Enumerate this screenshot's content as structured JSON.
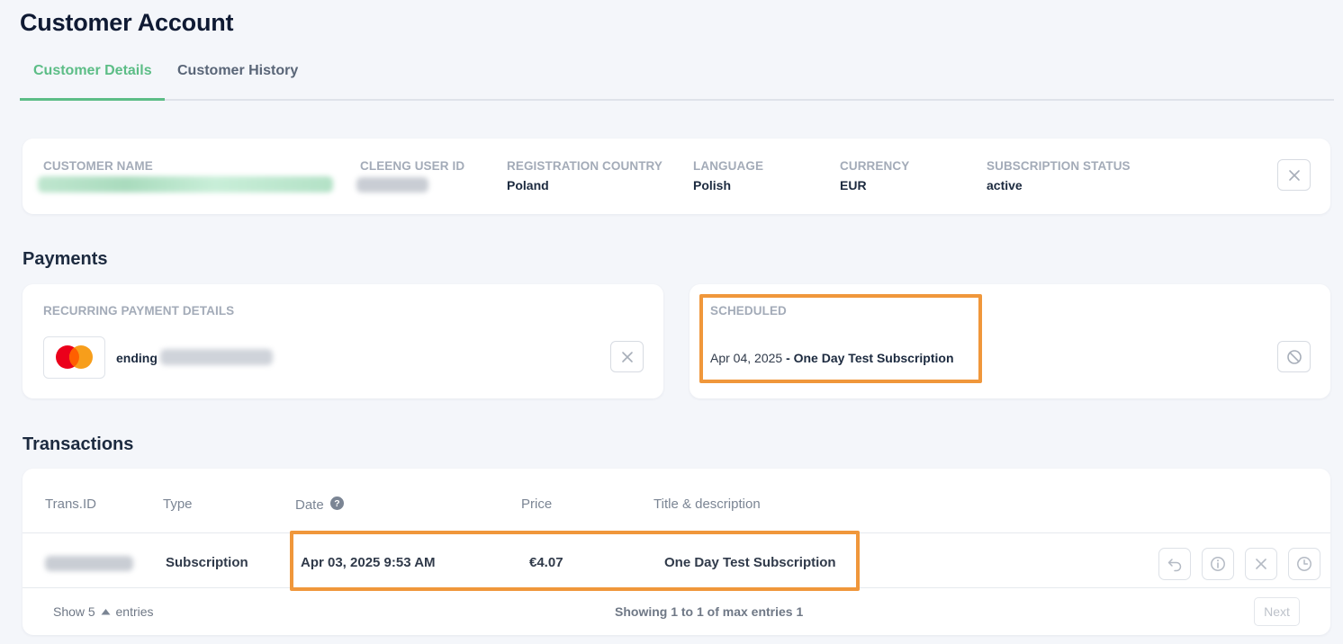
{
  "page": {
    "title": "Customer Account"
  },
  "tabs": [
    {
      "label": "Customer Details",
      "active": true
    },
    {
      "label": "Customer History",
      "active": false
    }
  ],
  "customer": {
    "name_label": "CUSTOMER NAME",
    "user_id_label": "CLEENG USER ID",
    "country_label": "REGISTRATION COUNTRY",
    "country": "Poland",
    "language_label": "LANGUAGE",
    "language": "Polish",
    "currency_label": "CURRENCY",
    "currency": "EUR",
    "status_label": "SUBSCRIPTION STATUS",
    "status": "active",
    "close_icon": "close-icon"
  },
  "payments": {
    "section_title": "Payments",
    "recurring_label": "RECURRING PAYMENT DETAILS",
    "card_brand_icon": "mastercard-icon",
    "ending_label": "ending",
    "scheduled_label": "SCHEDULED",
    "scheduled_date": "Apr 04, 2025",
    "scheduled_title": "- One Day Test Subscription",
    "cancel_icon": "block-icon"
  },
  "transactions": {
    "section_title": "Transactions",
    "columns": [
      "Trans.ID",
      "Type",
      "Date",
      "Price",
      "Title & description"
    ],
    "rows": [
      {
        "type": "Subscription",
        "date": "Apr 03, 2025 9:53 AM",
        "price": "€4.07",
        "title": "One Day Test Subscription"
      }
    ],
    "row_actions": [
      "undo-icon",
      "info-icon",
      "close-icon",
      "clock-icon"
    ],
    "footer": {
      "show_label": "Show",
      "page_size": "5",
      "entries_label": "entries",
      "showing_text": "Showing 1 to 1 of max entries 1",
      "next_label": "Next"
    }
  },
  "colors": {
    "accent": "#5cbd86",
    "highlight": "#f0973b",
    "background": "#f4f6fa"
  }
}
